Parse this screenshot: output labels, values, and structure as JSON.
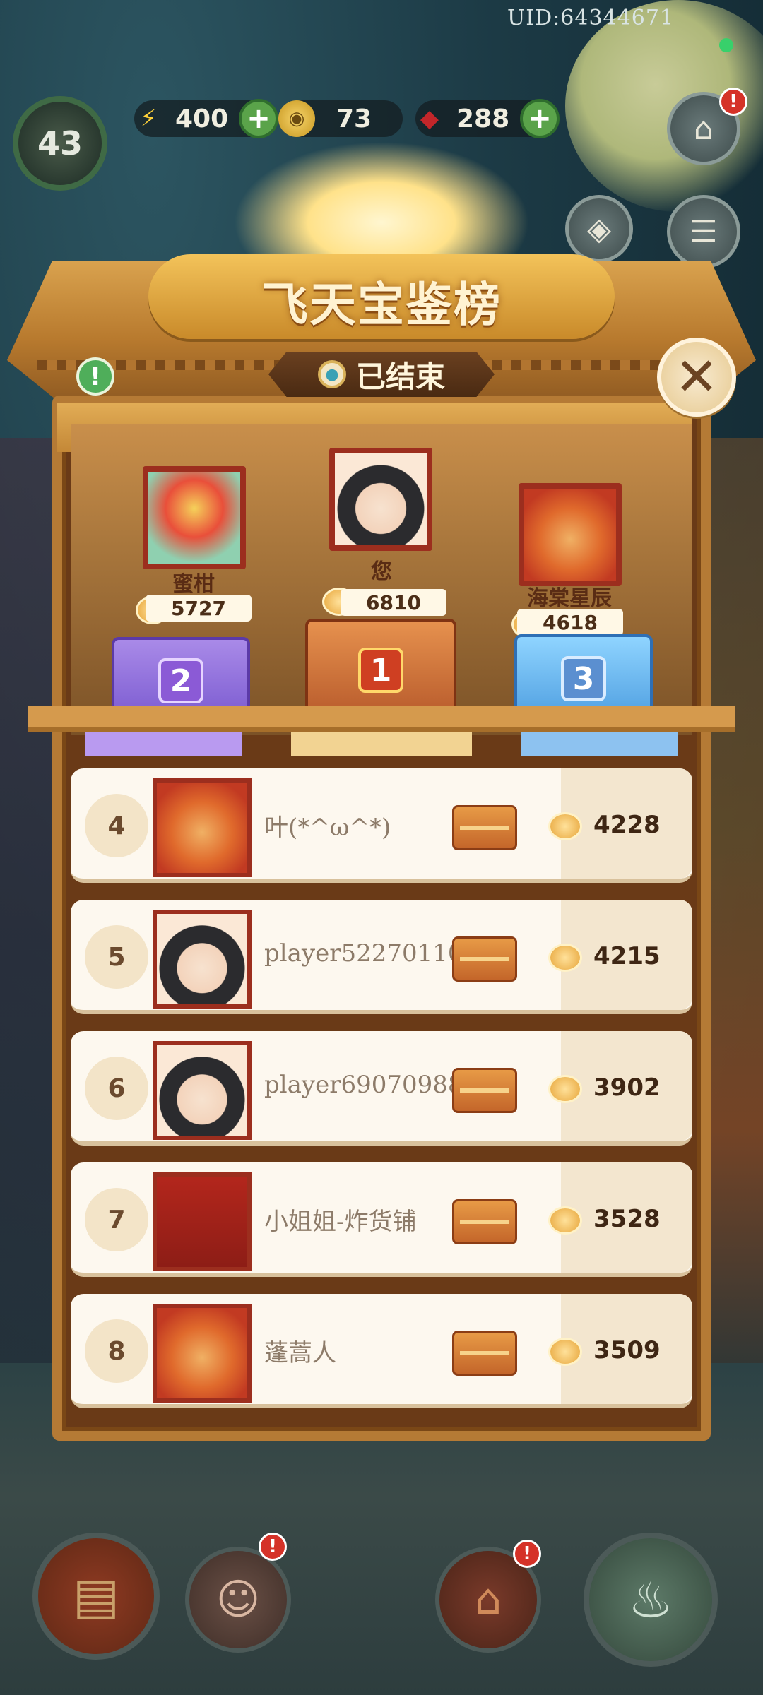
{
  "header": {
    "uid": "UID:64344671"
  },
  "hud": {
    "level": "43",
    "energy": "400",
    "coins": "73",
    "gems": "288"
  },
  "panel": {
    "title": "飞天宝鉴榜",
    "status": "已结束"
  },
  "podium": [
    {
      "rank": "2",
      "name": "蜜柑",
      "score": "5727",
      "avatar": "lion-dance-avatar"
    },
    {
      "rank": "1",
      "name": "您",
      "score": "6810",
      "avatar": "girl-avatar"
    },
    {
      "rank": "3",
      "name": "海棠星辰",
      "score": "4618",
      "avatar": "ox-avatar"
    }
  ],
  "leaderboard": [
    {
      "rank": "4",
      "name": "叶(*^ω^*)",
      "score": "4228",
      "avatar": "ox-avatar"
    },
    {
      "rank": "5",
      "name": "player52270110",
      "score": "4215",
      "avatar": "girl-avatar"
    },
    {
      "rank": "6",
      "name": "player69070988",
      "score": "3902",
      "avatar": "girl-avatar"
    },
    {
      "rank": "7",
      "name": "小姐姐-炸货铺",
      "score": "3528",
      "avatar": "photo-avatar"
    },
    {
      "rank": "8",
      "name": "蓬蒿人",
      "score": "3509",
      "avatar": "ox-avatar"
    }
  ],
  "colors": {
    "accent": "#b57a35",
    "frame": "#6a3a17",
    "badge": "#d53228"
  }
}
